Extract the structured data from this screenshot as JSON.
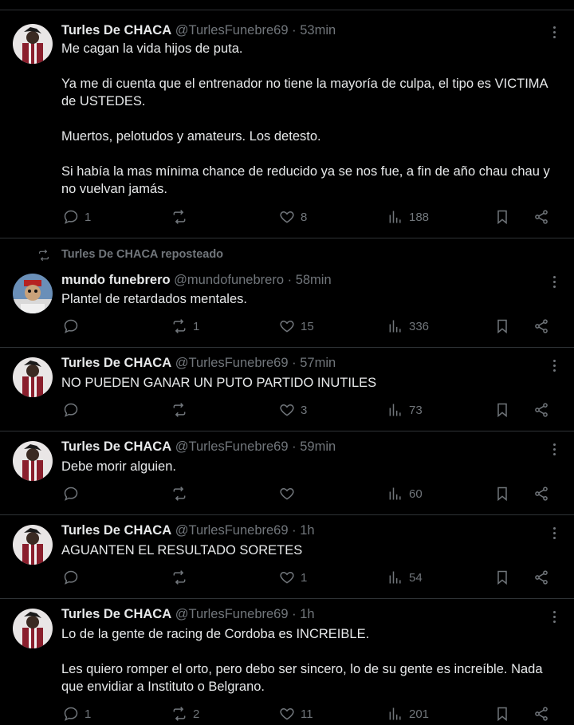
{
  "tweets": [
    {
      "name": "Turles De CHACA",
      "handle": "@TurlesFunebre69",
      "time": "53min",
      "text": "Me cagan la vida hijos de puta.\n\nYa me di cuenta que el entrenador no tiene la mayoría de culpa, el tipo es VICTIMA de USTEDES.\n\nMuertos, pelotudos y amateurs. Los detesto.\n\nSi había la mas mínima chance de reducido ya se nos fue, a fin de año chau chau y no vuelvan jamás.",
      "replies": "1",
      "reposts": "",
      "likes": "8",
      "views": "188",
      "avatar": "turles-avatar"
    },
    {
      "reposted_by": "Turles De CHACA reposteado",
      "name": "mundo funebrero",
      "handle": "@mundofunebrero",
      "time": "58min",
      "text": "Plantel de retardados mentales.",
      "replies": "",
      "reposts": "1",
      "likes": "15",
      "views": "336",
      "avatar": "mundo-avatar"
    },
    {
      "name": "Turles De CHACA",
      "handle": "@TurlesFunebre69",
      "time": "57min",
      "text": "NO PUEDEN GANAR UN PUTO PARTIDO INUTILES",
      "replies": "",
      "reposts": "",
      "likes": "3",
      "views": "73",
      "avatar": "turles-avatar"
    },
    {
      "name": "Turles De CHACA",
      "handle": "@TurlesFunebre69",
      "time": "59min",
      "text": "Debe morir alguien.",
      "replies": "",
      "reposts": "",
      "likes": "",
      "views": "60",
      "avatar": "turles-avatar"
    },
    {
      "name": "Turles De CHACA",
      "handle": "@TurlesFunebre69",
      "time": "1h",
      "text": "AGUANTEN EL RESULTADO SORETES",
      "replies": "",
      "reposts": "",
      "likes": "1",
      "views": "54",
      "avatar": "turles-avatar"
    },
    {
      "name": "Turles De CHACA",
      "handle": "@TurlesFunebre69",
      "time": "1h",
      "text": "Lo de la gente de racing de Cordoba es INCREIBLE.\n\nLes quiero romper el orto, pero debo ser sincero, lo de su gente es increíble. Nada que envidiar a Instituto o Belgrano.",
      "replies": "1",
      "reposts": "2",
      "likes": "11",
      "views": "201",
      "avatar": "turles-avatar"
    }
  ],
  "separator": "·",
  "colors": {
    "background": "#000000",
    "text": "#e7e9ea",
    "muted": "#71767b",
    "border": "#2f3336"
  }
}
